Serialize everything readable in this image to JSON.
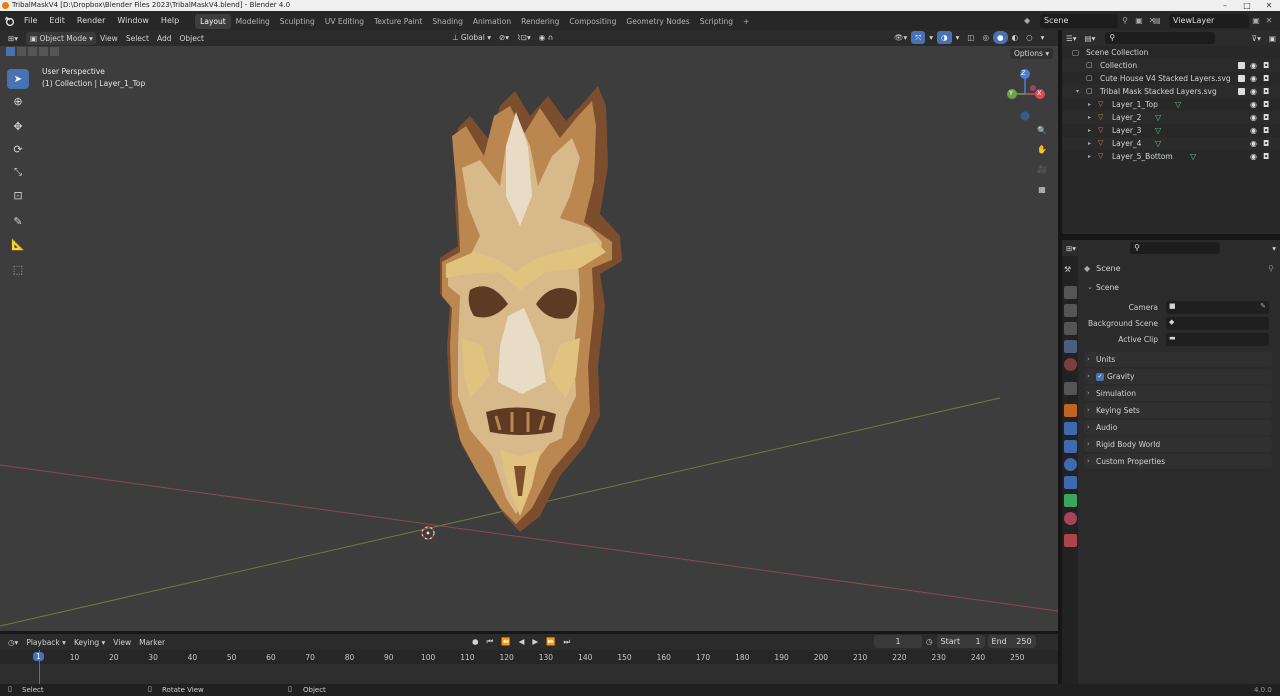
{
  "window": {
    "title": "TribalMaskV4 [D:\\Dropbox\\Blender Files 2023\\TribalMaskV4.blend] - Blender 4.0"
  },
  "menu": {
    "items": [
      "File",
      "Edit",
      "Render",
      "Window",
      "Help"
    ]
  },
  "workspaces": {
    "tabs": [
      "Layout",
      "Modeling",
      "Sculpting",
      "UV Editing",
      "Texture Paint",
      "Shading",
      "Animation",
      "Rendering",
      "Compositing",
      "Geometry Nodes",
      "Scripting"
    ],
    "active": "Layout",
    "add": "+"
  },
  "scene": {
    "name": "Scene",
    "view_layer": "ViewLayer"
  },
  "viewport_header": {
    "mode": "Object Mode",
    "view": "View",
    "select": "Select",
    "add": "Add",
    "object": "Object",
    "transform_orientation": "Global",
    "options": "Options"
  },
  "viewport": {
    "perspective": "User Perspective",
    "collection_info": "(1) Collection | Layer_1_Top",
    "gizmo": {
      "z": "Z",
      "y": "Y",
      "x": "X"
    },
    "colors": {
      "background": "#3d3d3d",
      "x_axis": "#a8424d",
      "y_axis": "#6c8a2f",
      "mask_dark": "#8a5a36",
      "mask_mid": "#c9a46b",
      "mask_light": "#e4d6be"
    }
  },
  "outliner": {
    "search_placeholder": "",
    "root": "Scene Collection",
    "items": [
      {
        "label": "Collection",
        "level": 1
      },
      {
        "label": "Cute House V4 Stacked Layers.svg",
        "level": 1
      },
      {
        "label": "Tribal Mask Stacked Layers.svg",
        "level": 1
      },
      {
        "label": "Layer_1_Top",
        "level": 2
      },
      {
        "label": "Layer_2",
        "level": 2
      },
      {
        "label": "Layer_3",
        "level": 2
      },
      {
        "label": "Layer_4",
        "level": 2
      },
      {
        "label": "Layer_5_Bottom",
        "level": 2
      }
    ]
  },
  "properties": {
    "context": "Scene",
    "panel_title": "Scene",
    "fields": [
      {
        "label": "Camera"
      },
      {
        "label": "Background Scene"
      },
      {
        "label": "Active Clip"
      }
    ],
    "sections": [
      "Units",
      "Gravity",
      "Simulation",
      "Keying Sets",
      "Audio",
      "Rigid Body World",
      "Custom Properties"
    ],
    "gravity_checked": true
  },
  "timeline": {
    "menus": [
      "Playback",
      "Keying",
      "View",
      "Marker"
    ],
    "current_frame": "1",
    "start_label": "Start",
    "start": "1",
    "end_label": "End",
    "end": "250",
    "ticks": [
      "1",
      "10",
      "20",
      "30",
      "40",
      "50",
      "60",
      "70",
      "80",
      "90",
      "100",
      "110",
      "120",
      "130",
      "140",
      "150",
      "160",
      "170",
      "180",
      "190",
      "200",
      "210",
      "220",
      "230",
      "240",
      "250"
    ]
  },
  "status": {
    "select": "Select",
    "rotate": "Rotate View",
    "object": "Object",
    "version": "4.0.0"
  }
}
